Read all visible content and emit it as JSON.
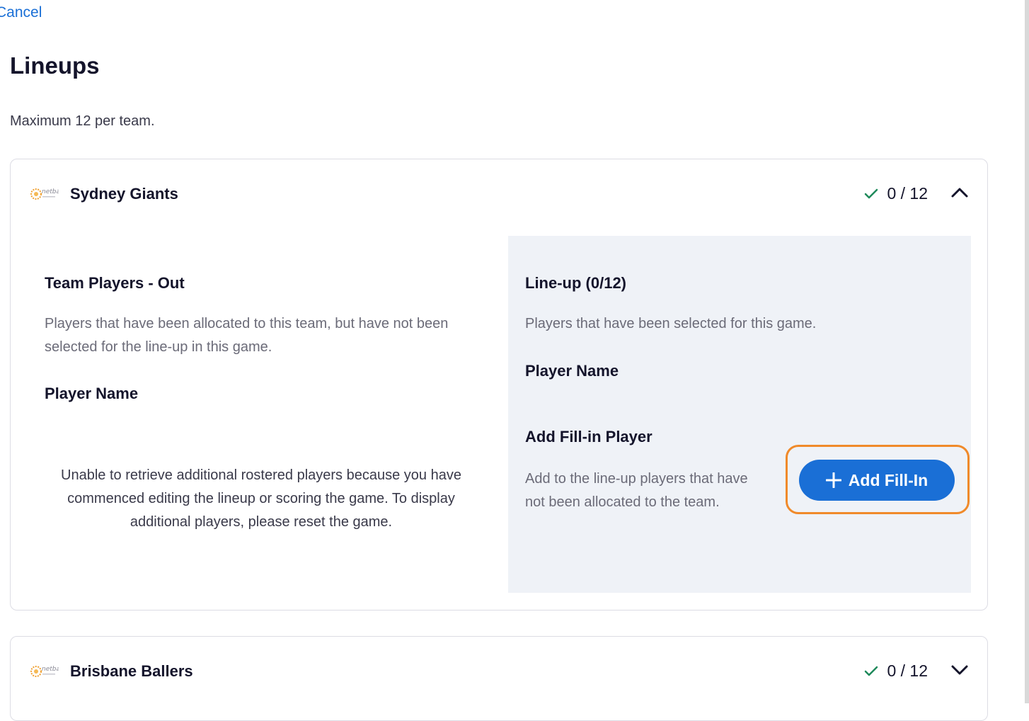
{
  "header": {
    "cancel_label": "Cancel"
  },
  "page": {
    "title": "Lineups",
    "subtitle": "Maximum 12 per team."
  },
  "teams": [
    {
      "name": "Sydney Giants",
      "count": "0 / 12",
      "expanded": true,
      "out_section": {
        "title": "Team Players - Out",
        "description": "Players that have been allocated to this team, but have not been selected for the line-up in this game.",
        "column_header": "Player Name",
        "message": "Unable to retrieve additional rostered players because you have commenced editing the lineup or scoring the game. To display additional players, please reset the game."
      },
      "lineup_section": {
        "title": "Line-up (0/12)",
        "description": "Players that have been selected for this game.",
        "column_header": "Player Name",
        "fillin_title": "Add Fill-in Player",
        "fillin_description": "Add to the line-up players that have not been allocated to the team.",
        "add_button_label": "Add Fill-In"
      }
    },
    {
      "name": "Brisbane Ballers",
      "count": "0 / 12",
      "expanded": false
    }
  ],
  "colors": {
    "accent": "#1a6fd6",
    "highlight": "#f08a2a",
    "check": "#1f8a5b",
    "panel": "#eff2f7"
  },
  "icons": {
    "logo": "netball-logo-icon",
    "check": "check-icon",
    "expand": "chevron-up-icon",
    "collapse": "chevron-down-icon",
    "add": "plus-icon"
  }
}
